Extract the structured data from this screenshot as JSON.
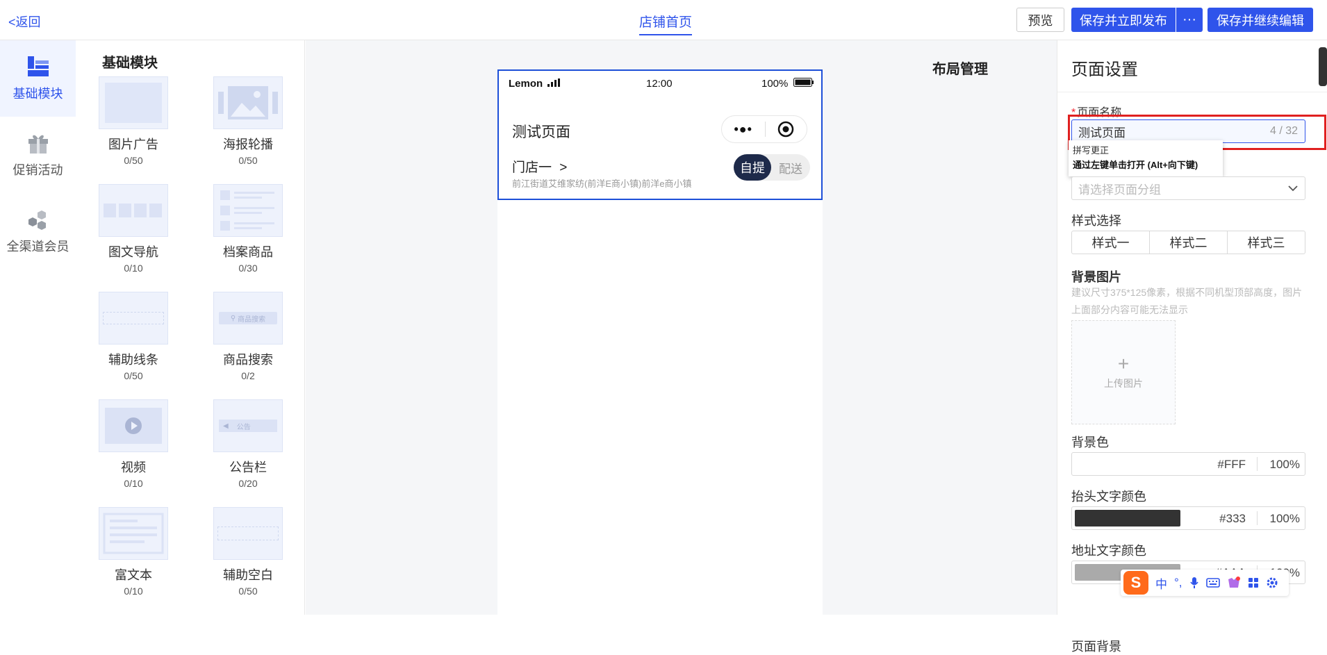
{
  "topbar": {
    "back_label": "<返回",
    "page_tab": "店铺首页",
    "preview_label": "预览",
    "publish_label": "保存并立即发布",
    "more_label": "···",
    "continue_label": "保存并继续编辑"
  },
  "rail": {
    "items": [
      {
        "label": "基础模块",
        "icon": "blocks-icon"
      },
      {
        "label": "促销活动",
        "icon": "gift-icon"
      },
      {
        "label": "全渠道会员",
        "icon": "members-icon"
      }
    ]
  },
  "modules": {
    "title": "基础模块",
    "items": [
      {
        "name": "图片广告",
        "count": "0/50"
      },
      {
        "name": "海报轮播",
        "count": "0/50"
      },
      {
        "name": "图文导航",
        "count": "0/10"
      },
      {
        "name": "档案商品",
        "count": "0/30"
      },
      {
        "name": "辅助线条",
        "count": "0/50"
      },
      {
        "name": "商品搜索",
        "count": "0/2",
        "thumb_text": "商品搜索"
      },
      {
        "name": "视频",
        "count": "0/10"
      },
      {
        "name": "公告栏",
        "count": "0/20",
        "thumb_text": "公告"
      },
      {
        "name": "富文本",
        "count": "0/10"
      },
      {
        "name": "辅助空白",
        "count": "0/50"
      }
    ]
  },
  "canvas": {
    "layout_title": "布局管理",
    "phone": {
      "carrier": "Lemon",
      "time": "12:00",
      "battery": "100%",
      "page_title": "测试页面",
      "store_name": "门店一",
      "store_arrow": ">",
      "store_address": "前江街道艾维家纺(前洋E商小镇)前洋e商小镇",
      "toggle_on": "自提",
      "toggle_off": "配送"
    }
  },
  "settings": {
    "title": "页面设置",
    "name_label": "页面名称",
    "name_value": "测试页面",
    "name_counter": "4 / 32",
    "tooltip_line1": "拼写更正",
    "tooltip_line2": "通过左键单击打开 (Alt+向下键)",
    "group_placeholder": "请选择页面分组",
    "style_label": "样式选择",
    "style_options": [
      "样式一",
      "样式二",
      "样式三"
    ],
    "bg_image_label": "背景图片",
    "bg_image_hint": "建议尺寸375*125像素，根据不同机型顶部高度，图片上面部分内容可能无法显示",
    "upload_plus": "+",
    "upload_label": "上传图片",
    "bg_color_label": "背景色",
    "bg_color_hex": "#FFF",
    "bg_color_pct": "100%",
    "header_color_label": "抬头文字颜色",
    "header_color_hex": "#333",
    "header_color_pct": "100%",
    "header_color_value": "#333333",
    "address_color_label": "地址文字颜色",
    "address_color_hex": "#AAA",
    "address_color_pct": "100%",
    "address_color_value": "#AAAAAA",
    "page_bg_label": "页面背景"
  },
  "ime": {
    "logo": "S",
    "lang": "中",
    "punct": "°,"
  }
}
